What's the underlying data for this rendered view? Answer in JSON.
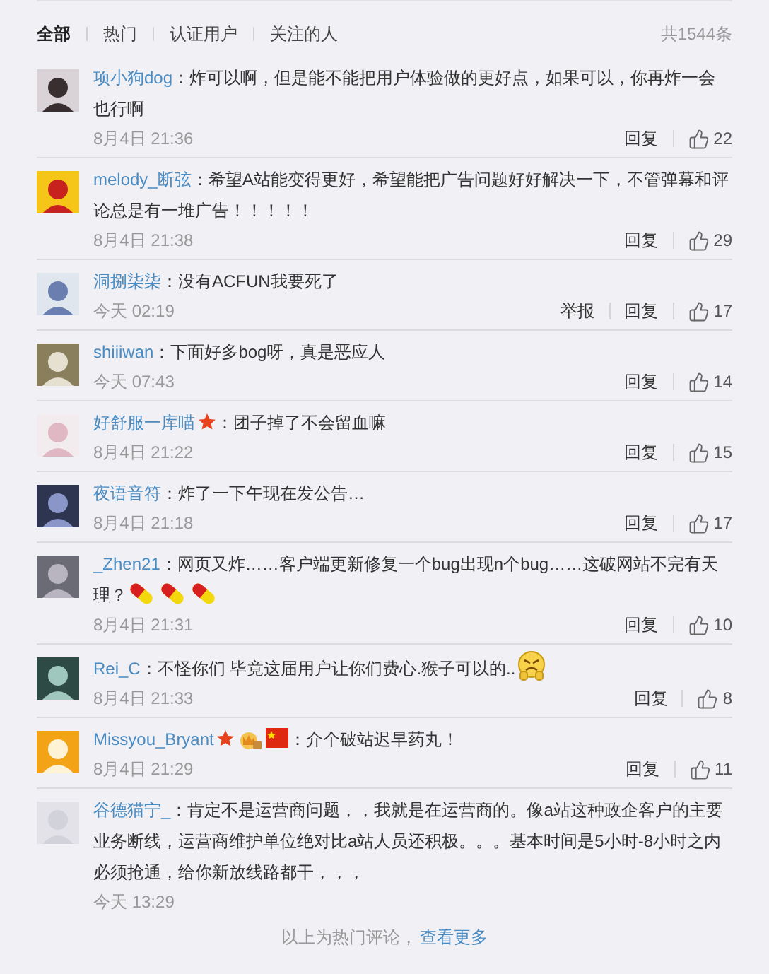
{
  "tabs": [
    {
      "label": "全部",
      "selected": true
    },
    {
      "label": "热门",
      "selected": false
    },
    {
      "label": "认证用户",
      "selected": false
    },
    {
      "label": "关注的人",
      "selected": false
    }
  ],
  "total": "共1544条",
  "comments": [
    {
      "user": "项小狗dog",
      "text": "：炸可以啊，但是能不能把用户体验做的更好点，如果可以，你再炸一会也行啊",
      "time": "8月4日 21:36",
      "actions": [
        "回复"
      ],
      "likes": "22"
    },
    {
      "user": "melody_断弦",
      "text": "：希望A站能变得更好，希望能把广告问题好好解决一下，不管弹幕和评论总是有一堆广告！！！！！",
      "time": "8月4日 21:38",
      "actions": [
        "回复"
      ],
      "likes": "29"
    },
    {
      "user": "洞捌柒柒",
      "text": "：没有ACFUN我要死了",
      "time": "今天 02:19",
      "actions": [
        "举报",
        "回复"
      ],
      "likes": "17"
    },
    {
      "user": "shiiiwan",
      "text": "：下面好多bog呀，真是恶应人",
      "time": "今天 07:43",
      "actions": [
        "回复"
      ],
      "likes": "14"
    },
    {
      "user": "好舒服一库喵",
      "badges": [
        {
          "kind": "star"
        }
      ],
      "text": "：团子掉了不会留血嘛",
      "time": "8月4日 21:22",
      "actions": [
        "回复"
      ],
      "likes": "15"
    },
    {
      "user": "夜语音符",
      "text": "：炸了一下午现在发公告…",
      "time": "8月4日 21:18",
      "actions": [
        "回复"
      ],
      "likes": "17"
    },
    {
      "user": "_Zhen21",
      "text": "：网页又炸……客户端更新修复一个bug出现n个bug……这破网站不完有天理？",
      "emoji": [
        {
          "kind": "pill"
        },
        {
          "kind": "pill"
        },
        {
          "kind": "pill"
        }
      ],
      "time": "8月4日 21:31",
      "actions": [
        "回复"
      ],
      "likes": "10"
    },
    {
      "user": "Rei_C",
      "text": "：不怪你们 毕竟这届用户让你们费心.猴子可以的..",
      "emoji": [
        {
          "kind": "grumpy"
        }
      ],
      "time": "8月4日 21:33",
      "actions": [
        "回复"
      ],
      "likes": "8"
    },
    {
      "user": "Missyou_Bryant",
      "badges": [
        {
          "kind": "star"
        },
        {
          "kind": "crown"
        },
        {
          "kind": "flag"
        }
      ],
      "text": "：介个破站迟早药丸！",
      "time": "8月4日 21:29",
      "actions": [
        "回复"
      ],
      "likes": "11"
    },
    {
      "user": "谷德猫宁_",
      "text": "：肯定不是运营商问题，，我就是在运营商的。像a站这种政企客户的主要业务断线，运营商维护单位绝对比a站人员还积极。。。基本时间是5小时-8小时之内必须抢通，给你新放线路都干，，，",
      "time": "今天 13:29"
    }
  ],
  "footer": {
    "text": "以上为热门评论，",
    "link": "查看更多"
  }
}
